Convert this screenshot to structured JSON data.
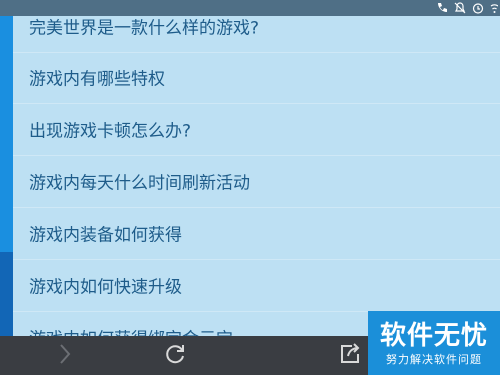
{
  "status_bar": {
    "icons": [
      "phone-icon",
      "bell-off-icon",
      "alarm-icon",
      "wifi-icon"
    ]
  },
  "faq": {
    "items": [
      {
        "label": "完美世界是一款什么样的游戏?"
      },
      {
        "label": "游戏内有哪些特权"
      },
      {
        "label": "出现游戏卡顿怎么办?"
      },
      {
        "label": "游戏内每天什么时间刷新活动"
      },
      {
        "label": "游戏内装备如何获得"
      },
      {
        "label": "游戏内如何快速升级"
      },
      {
        "label": "游戏内如何获得绑定金元宝"
      }
    ]
  },
  "bottom_nav": {
    "icons": [
      "forward-icon",
      "refresh-icon",
      "share-icon"
    ]
  },
  "watermark": {
    "title": "软件无忧",
    "subtitle": "努力解决软件问题"
  },
  "colors": {
    "list_background": "#bde0f3",
    "accent_strip": "#1a8fe0",
    "text": "#1e5c8a",
    "bottom_bar": "#3a3d42",
    "watermark": "#1b8fd9"
  }
}
